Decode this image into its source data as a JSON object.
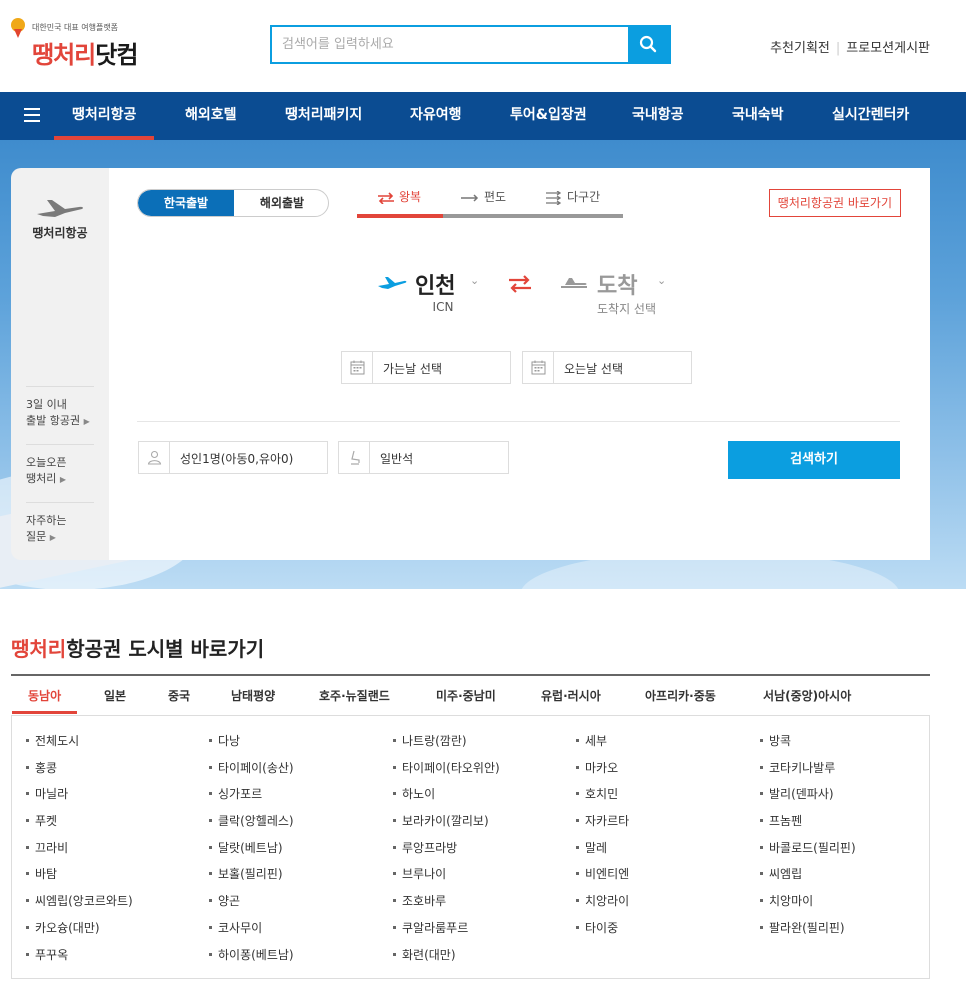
{
  "logo": {
    "tagline": "대한민국 대표 여행플랫폼",
    "brand_red": "땡처리",
    "brand_dark": "닷컴"
  },
  "search": {
    "placeholder": "검색어를 입력하세요"
  },
  "top_links": [
    "추천기획전",
    "프로모션게시판"
  ],
  "nav": {
    "items": [
      "땡처리항공",
      "해외호텔",
      "땡처리패키지",
      "자유여행",
      "투어&입장권",
      "국내항공",
      "국내숙박",
      "실시간렌터카"
    ],
    "active_index": 0
  },
  "side_panel": {
    "title": "땡처리항공",
    "links": [
      {
        "line1": "3일 이내",
        "line2": "출발 항공권"
      },
      {
        "line1": "오늘오픈",
        "line2": "땡처리"
      },
      {
        "line1": "자주하는",
        "line2": "질문"
      }
    ]
  },
  "booking": {
    "departure_toggle": [
      "한국출발",
      "해외출발"
    ],
    "trip_types": [
      "왕복",
      "편도",
      "다구간"
    ],
    "shortcut_button": "땡처리항공권 바로가기",
    "origin": {
      "city": "인천",
      "code": "ICN"
    },
    "destination": {
      "city": "도착",
      "sub": "도착지 선택"
    },
    "depart_date": "가는날 선택",
    "return_date": "오는날 선택",
    "passengers": "성인1명(아동0,유아0)",
    "cabin": "일반석",
    "search_button": "검색하기"
  },
  "city_section": {
    "title_red": "땡처리",
    "title_rest": "항공권 도시별 바로가기",
    "regions": [
      "동남아",
      "일본",
      "중국",
      "남태평양",
      "호주·뉴질랜드",
      "미주·중남미",
      "유럽·러시아",
      "아프리카·중동",
      "서남(중앙)아시아"
    ],
    "columns": [
      [
        "전체도시",
        "홍콩",
        "마닐라",
        "푸켓",
        "끄라비",
        "바탐",
        "씨엠립(앙코르와트)",
        "카오슝(대만)",
        "푸꾸옥"
      ],
      [
        "다낭",
        "타이페이(송산)",
        "싱가포르",
        "클락(앙헬레스)",
        "달랏(베트남)",
        "보홀(필리핀)",
        "양곤",
        "코사무이",
        "하이퐁(베트남)"
      ],
      [
        "나트랑(깜란)",
        "타이페이(타오위안)",
        "하노이",
        "보라카이(깔리보)",
        "루앙프라방",
        "브루나이",
        "조호바루",
        "쿠알라룸푸르",
        "화련(대만)"
      ],
      [
        "세부",
        "마카오",
        "호치민",
        "자카르타",
        "말레",
        "비엔티엔",
        "치앙라이",
        "타이중"
      ],
      [
        "방콕",
        "코타키나발루",
        "발리(덴파사)",
        "프놈펜",
        "바콜로드(필리핀)",
        "씨엠립",
        "치앙마이",
        "팔라완(필리핀)"
      ]
    ]
  },
  "colors": {
    "brand_blue": "#0b9ee0",
    "nav_blue": "#0b4c92",
    "accent_red": "#e2453a"
  }
}
